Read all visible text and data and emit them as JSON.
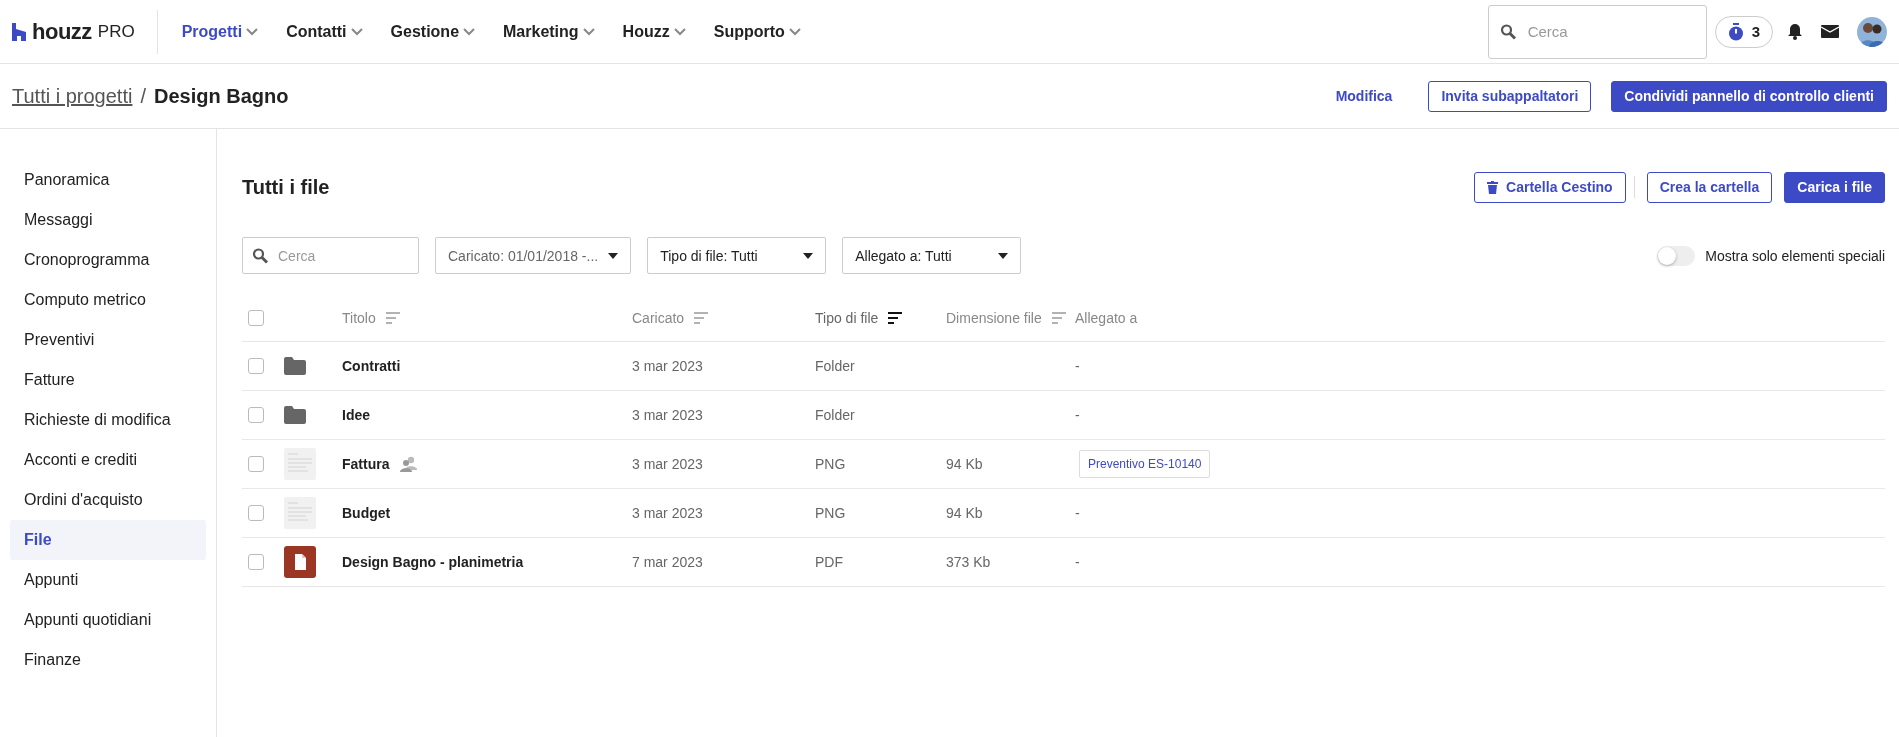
{
  "brand": {
    "name": "houzz",
    "suffix": "PRO"
  },
  "nav": [
    {
      "label": "Progetti",
      "selected": true
    },
    {
      "label": "Contatti",
      "selected": false
    },
    {
      "label": "Gestione",
      "selected": false
    },
    {
      "label": "Marketing",
      "selected": false
    },
    {
      "label": "Houzz",
      "selected": false
    },
    {
      "label": "Supporto",
      "selected": false
    }
  ],
  "top_search": {
    "placeholder": "Cerca"
  },
  "timer_count": "3",
  "breadcrumb": {
    "parent": "Tutti i progetti",
    "separator": "/",
    "current": "Design Bagno"
  },
  "header_actions": {
    "edit": "Modifica",
    "invite": "Invita subappaltatori",
    "share": "Condividi pannello di controllo clienti"
  },
  "sidebar": {
    "items": [
      {
        "label": "Panoramica",
        "selected": false
      },
      {
        "label": "Messaggi",
        "selected": false
      },
      {
        "label": "Cronoprogramma",
        "selected": false
      },
      {
        "label": "Computo metrico",
        "selected": false
      },
      {
        "label": "Preventivi",
        "selected": false
      },
      {
        "label": "Fatture",
        "selected": false
      },
      {
        "label": "Richieste di modifica",
        "selected": false
      },
      {
        "label": "Acconti e crediti",
        "selected": false
      },
      {
        "label": "Ordini d'acquisto",
        "selected": false
      },
      {
        "label": "File",
        "selected": true
      },
      {
        "label": "Appunti",
        "selected": false
      },
      {
        "label": "Appunti quotidiani",
        "selected": false
      },
      {
        "label": "Finanze",
        "selected": false
      }
    ]
  },
  "page_title": "Tutti i file",
  "page_actions": {
    "trash": "Cartella Cestino",
    "new_folder": "Crea la cartella",
    "upload": "Carica i file"
  },
  "filters": {
    "search": {
      "placeholder": "Cerca"
    },
    "dropdowns": [
      "Caricato: 01/01/2018 -...",
      "Tipo di file: Tutti",
      "Allegato a: Tutti"
    ]
  },
  "special_toggle": {
    "label": "Mostra solo elementi speciali",
    "on": false
  },
  "table": {
    "all_checked": false,
    "columns": [
      {
        "label": "Titolo",
        "sortable": true,
        "sorted": false
      },
      {
        "label": "Caricato",
        "sortable": true,
        "sorted": false
      },
      {
        "label": "Tipo di file",
        "sortable": true,
        "sorted": true
      },
      {
        "label": "Dimensione file",
        "sortable": true,
        "sorted": false
      },
      {
        "label": "Allegato a",
        "sortable": false,
        "sorted": false
      }
    ],
    "rows": [
      {
        "kind": "folder",
        "checked": false,
        "title": "Contratti",
        "shared": false,
        "uploaded": "3 mar 2023",
        "type": "Folder",
        "attached": {
          "kind": "text",
          "text": "-"
        }
      },
      {
        "kind": "folder",
        "checked": false,
        "title": "Idee",
        "shared": false,
        "uploaded": "3 mar 2023",
        "type": "Folder",
        "attached": {
          "kind": "text",
          "text": "-"
        }
      },
      {
        "kind": "image",
        "checked": false,
        "title": "Fattura",
        "shared": true,
        "uploaded": "3 mar 2023",
        "type": "PNG",
        "size": "94 Kb",
        "attached": {
          "kind": "tag",
          "text": "Preventivo ES-10140"
        }
      },
      {
        "kind": "image",
        "checked": false,
        "title": "Budget",
        "shared": false,
        "uploaded": "3 mar 2023",
        "type": "PNG",
        "size": "94 Kb",
        "attached": {
          "kind": "text",
          "text": "-"
        }
      },
      {
        "kind": "pdf",
        "checked": false,
        "title": "Design Bagno - planimetria",
        "shared": false,
        "uploaded": "7 mar 2023",
        "type": "PDF",
        "size": "373 Kb",
        "attached": {
          "kind": "text",
          "text": "-"
        }
      }
    ]
  }
}
